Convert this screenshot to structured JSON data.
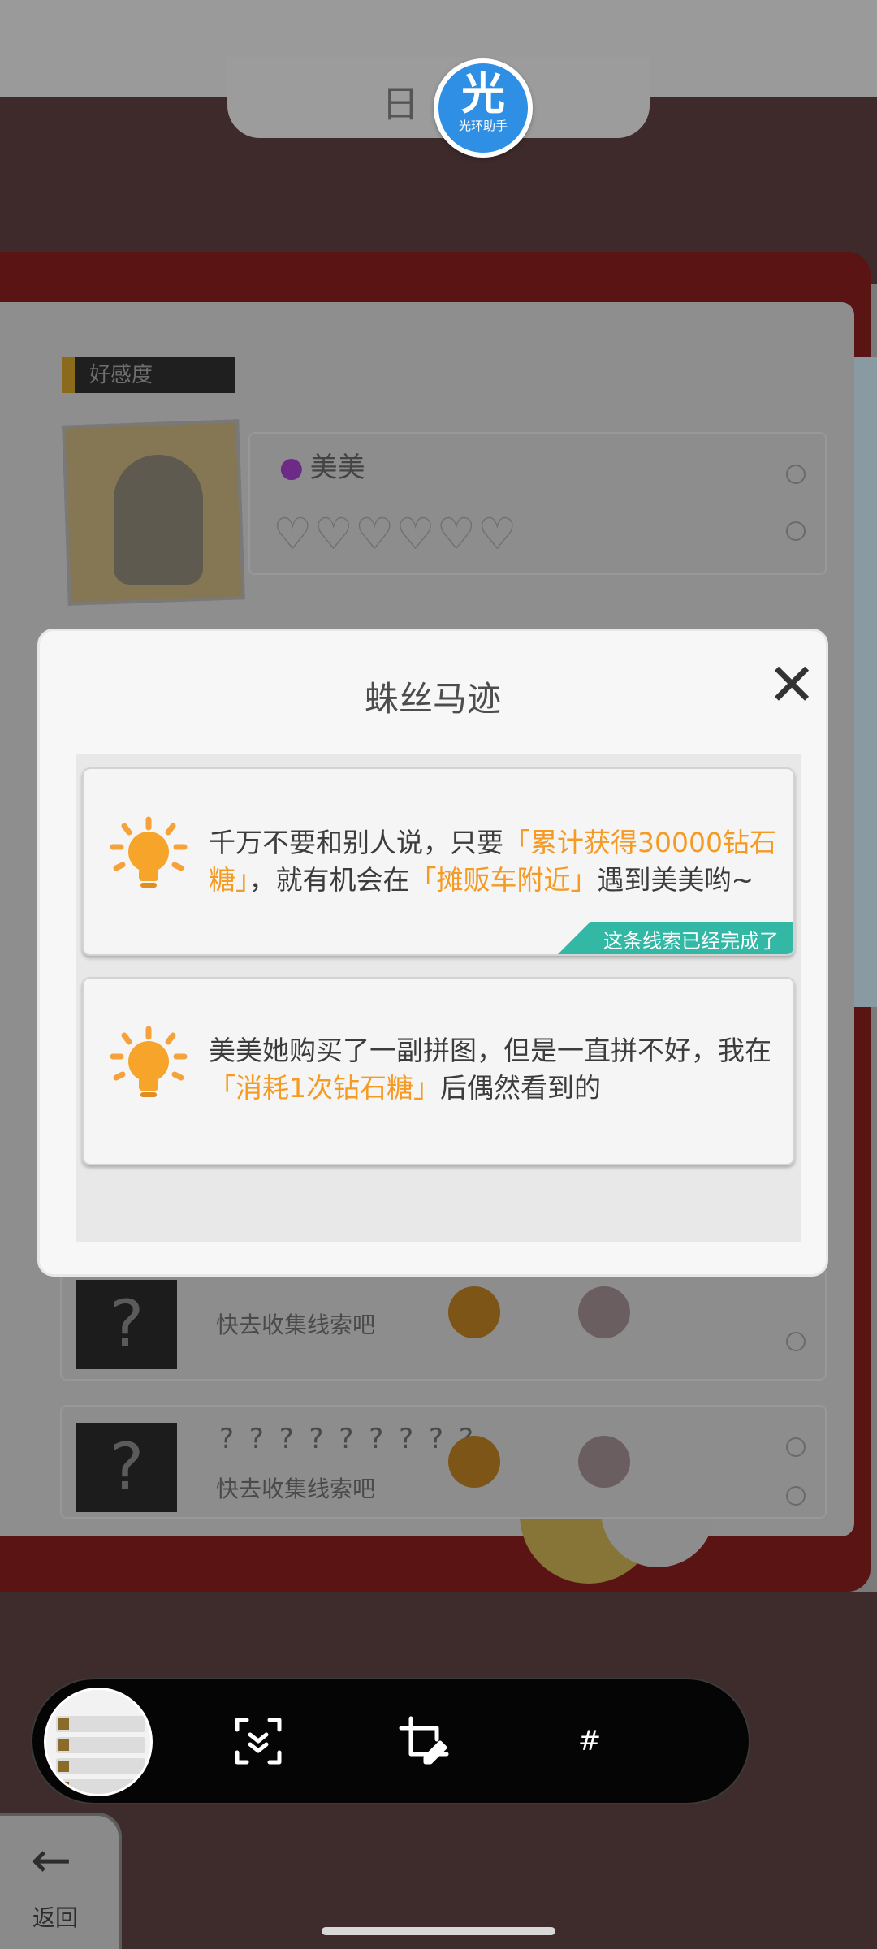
{
  "background": {
    "tab_title": "日",
    "section_label": "好感度",
    "character_name": "美美",
    "hearts": "♡♡♡♡♡♡",
    "unknown_rows": [
      {
        "mark": "?",
        "title": "? ? ? ? ? ? ? ? ?",
        "subtitle": "快去收集线索吧"
      },
      {
        "mark": "?",
        "title": "? ? ? ? ? ? ? ? ?",
        "subtitle": "快去收集线索吧"
      }
    ],
    "back_label": "返回",
    "back_arrow": "←"
  },
  "helper": {
    "logo_char": "光",
    "logo_caption": "光环助手"
  },
  "modal": {
    "title": "蛛丝马迹",
    "close_icon": "✕",
    "clues": [
      {
        "parts": [
          {
            "text": "千万不要和别人说，只要",
            "highlight": false
          },
          {
            "text": "「累计获得30000钻石糖」",
            "highlight": true
          },
          {
            "text": "，就有机会在",
            "highlight": false
          },
          {
            "text": "「摊贩车附近」",
            "highlight": true
          },
          {
            "text": "遇到美美哟~",
            "highlight": false
          }
        ],
        "status": "这条线索已经完成了"
      },
      {
        "parts": [
          {
            "text": "美美她购买了一副拼图，但是一直拼不好，我在",
            "highlight": false
          },
          {
            "text": "「消耗1次钻石糖」",
            "highlight": true
          },
          {
            "text": "后偶然看到的",
            "highlight": false
          }
        ],
        "status": ""
      }
    ]
  },
  "toolbar": {
    "scroll_capture_icon": "scroll-capture-icon",
    "crop_edit_icon": "crop-edit-icon",
    "tag_label": "#"
  },
  "colors": {
    "highlight": "#f59a23",
    "done_tag": "#33b8a6",
    "helper_blue": "#2f8fe4"
  }
}
